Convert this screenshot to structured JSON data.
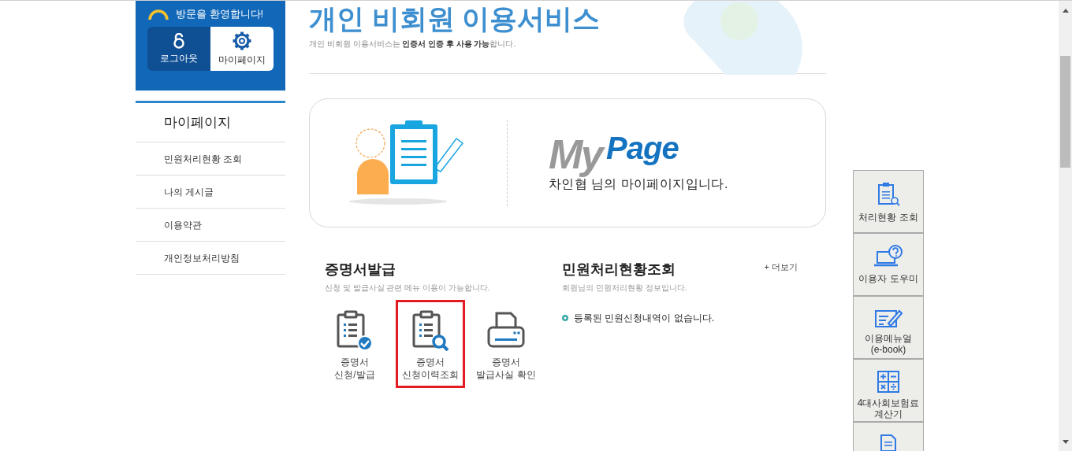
{
  "header": {
    "greeting": "방문을 환영합니다!",
    "buttons": [
      {
        "kind": "logout",
        "label": "로그아웃",
        "selected": false
      },
      {
        "kind": "settings",
        "label": "마이페이지",
        "selected": true
      }
    ]
  },
  "sidebar": {
    "title": "마이페이지",
    "items": [
      "민원처리현황 조회",
      "나의 게시글",
      "이용약관",
      "개인정보처리방침"
    ]
  },
  "page": {
    "title": "개인 비회원 이용서비스",
    "subtitle": "개인 비회원 이용서비스는 **인증서 인증 후 사용 가능**합니다."
  },
  "banner": {
    "logo_first": "My",
    "logo_second": "Page",
    "message": "차인협 님의 마이페이지입니다."
  },
  "certificates": {
    "title": "증명서발급",
    "description": "신청 및 발급사실 관련 메뉴 이용이 가능합니다.",
    "items": [
      {
        "kind": "apply",
        "lines": [
          "증명서",
          "신청/발급"
        ],
        "highlighted": false
      },
      {
        "kind": "history",
        "lines": [
          "증명서",
          "신청이력조회"
        ],
        "highlighted": true
      },
      {
        "kind": "print",
        "lines": [
          "증명서",
          "발급사실 확인"
        ],
        "highlighted": false
      }
    ]
  },
  "status": {
    "title": "민원처리현황조회",
    "description": "회원님의 민원처리현황 정보입니다.",
    "more": "+ 더보기",
    "empty": "등록된 민원신청내역이 없습니다."
  },
  "quick_menu": [
    {
      "kind": "status",
      "lines": [
        "처리현황 조회"
      ]
    },
    {
      "kind": "help",
      "lines": [
        "이용자 도우미"
      ]
    },
    {
      "kind": "manual",
      "lines": [
        "이용메뉴얼",
        "(e-book)"
      ]
    },
    {
      "kind": "calculator",
      "lines": [
        "4대사회보험료",
        "계산기"
      ]
    },
    {
      "kind": "document"
    }
  ]
}
